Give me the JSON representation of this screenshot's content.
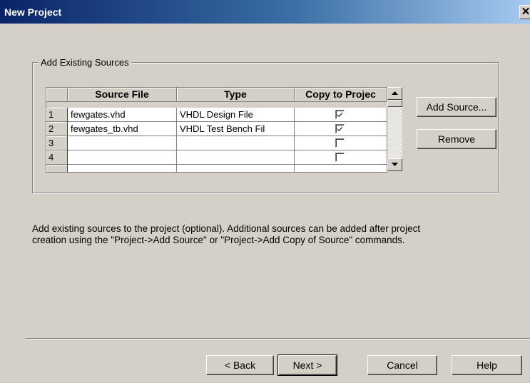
{
  "window": {
    "title": "New Project",
    "close_glyph": "✕"
  },
  "group": {
    "legend": "Add Existing Sources"
  },
  "grid": {
    "headers": [
      "",
      "Source File",
      "Type",
      "Copy to Projec"
    ],
    "rows": [
      {
        "num": "1",
        "file": "fewgates.vhd",
        "type": "VHDL Design File",
        "copy": true
      },
      {
        "num": "2",
        "file": "fewgates_tb.vhd",
        "type": "VHDL Test Bench Fil",
        "copy": true
      },
      {
        "num": "3",
        "file": "",
        "type": "",
        "copy": false
      },
      {
        "num": "4",
        "file": "",
        "type": "",
        "copy": false
      }
    ]
  },
  "side_buttons": {
    "add_source": "Add Source...",
    "remove": "Remove"
  },
  "description": {
    "line1": "Add existing sources to the project (optional). Additional sources can be added after project",
    "line2": " creation using the \"Project->Add Source\" or \"Project->Add Copy of Source\" commands."
  },
  "footer": {
    "back": "< Back",
    "next": "Next >",
    "cancel": "Cancel",
    "help": "Help"
  }
}
